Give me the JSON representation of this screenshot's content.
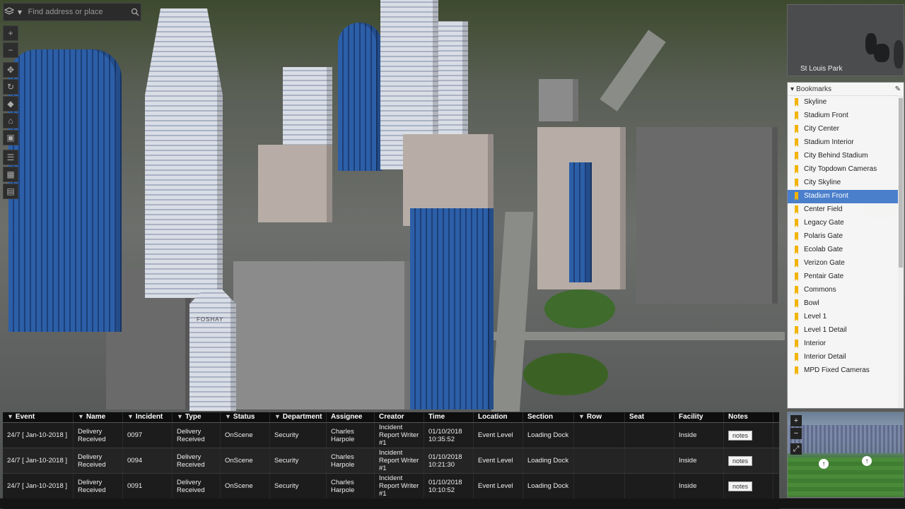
{
  "search": {
    "placeholder": "Find address or place"
  },
  "toolbar": {
    "zoom_in": "+",
    "zoom_out": "−"
  },
  "overview": {
    "label": "St Louis Park"
  },
  "bookmarks": {
    "title": "Bookmarks",
    "items": [
      "Skyline",
      "Stadium Front",
      "City Center",
      "Stadium Interior",
      "City Behind Stadium",
      "City Topdown Cameras",
      "City Skyline",
      "Stadium Front",
      "Center Field",
      "Legacy Gate",
      "Polaris Gate",
      "Ecolab Gate",
      "Verizon Gate",
      "Pentair Gate",
      "Commons",
      "Bowl",
      "Level 1",
      "Level 1 Detail",
      "Interior",
      "Interior Detail",
      "MPD Fixed Cameras"
    ],
    "selected_index": 7
  },
  "table": {
    "columns": [
      "Event",
      "Name",
      "Incident",
      "Type",
      "Status",
      "Department",
      "Assignee",
      "Creator",
      "Time",
      "Location",
      "Section",
      "Row",
      "Seat",
      "Facility",
      "Notes"
    ],
    "filterable": [
      true,
      true,
      true,
      true,
      true,
      true,
      false,
      false,
      false,
      false,
      false,
      true,
      false,
      false,
      false
    ],
    "rows": [
      [
        "24/7 [ Jan-10-2018 ]",
        "Delivery Received",
        "0097",
        "Delivery Received",
        "OnScene",
        "Security",
        "Charles Harpole",
        "Incident Report Writer #1",
        "01/10/2018 10:35:52",
        "Event Level",
        "Loading Dock",
        "",
        "",
        "Inside",
        "notes"
      ],
      [
        "24/7 [ Jan-10-2018 ]",
        "Delivery Received",
        "0094",
        "Delivery Received",
        "OnScene",
        "Security",
        "Charles Harpole",
        "Incident Report Writer #1",
        "01/10/2018 10:21:30",
        "Event Level",
        "Loading Dock",
        "",
        "",
        "Inside",
        "notes"
      ],
      [
        "24/7 [ Jan-10-2018 ]",
        "Delivery Received",
        "0091",
        "Delivery Received",
        "OnScene",
        "Security",
        "Charles Harpole",
        "Incident Report Writer #1",
        "01/10/2018 10:10:52",
        "Event Level",
        "Loading Dock",
        "",
        "",
        "Inside",
        "notes"
      ]
    ]
  },
  "thumbnail": {
    "zoom_in": "+",
    "zoom_out": "−"
  },
  "building_sign": "FOSHAY"
}
